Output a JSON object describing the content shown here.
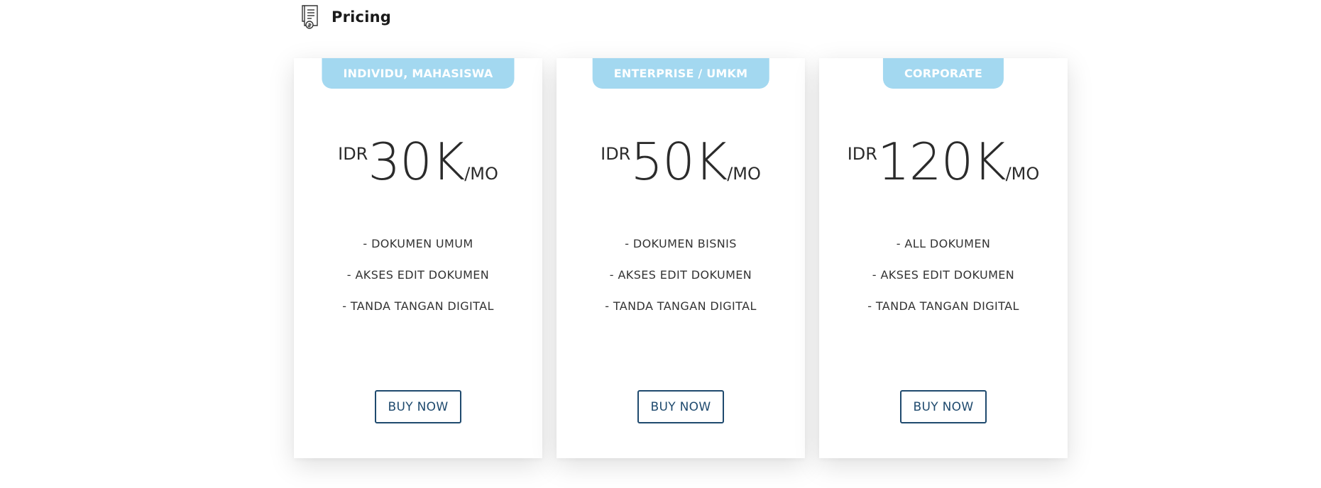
{
  "header": {
    "title": "Pricing",
    "icon": "invoice-document-icon"
  },
  "colors": {
    "badge_bg": "#a3d8f0",
    "badge_text": "#ffffff",
    "button_border": "#1f4a6e",
    "text": "#2b2b2b"
  },
  "plans": [
    {
      "tier": "INDIVIDU, MAHASISWA",
      "currency": "IDR",
      "amount": "30K",
      "period": "/MO",
      "features": [
        "- DOKUMEN UMUM",
        "- AKSES EDIT DOKUMEN",
        "- TANDA TANGAN DIGITAL"
      ],
      "button_label": "BUY NOW"
    },
    {
      "tier": "ENTERPRISE / UMKM",
      "currency": "IDR",
      "amount": "50K",
      "period": "/MO",
      "features": [
        "- DOKUMEN BISNIS",
        "- AKSES EDIT DOKUMEN",
        "- TANDA TANGAN DIGITAL"
      ],
      "button_label": "BUY NOW"
    },
    {
      "tier": "CORPORATE",
      "currency": "IDR",
      "amount": "120K",
      "period": "/MO",
      "features": [
        "- ALL DOKUMEN",
        "- AKSES EDIT DOKUMEN",
        "- TANDA TANGAN DIGITAL"
      ],
      "button_label": "BUY NOW"
    }
  ]
}
